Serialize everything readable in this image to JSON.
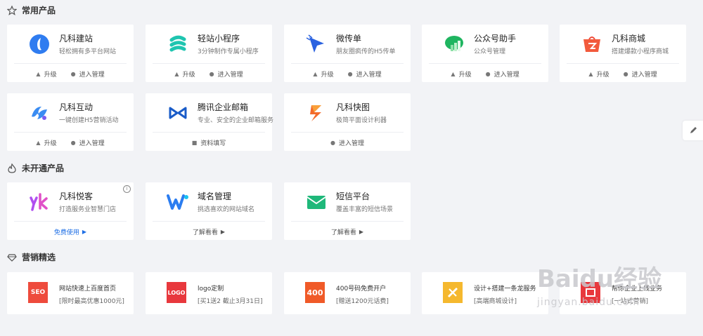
{
  "sections": {
    "common": "常用产品",
    "unopened": "未开通产品",
    "marketing": "营销精选"
  },
  "common_products": [
    {
      "name": "凡科建站",
      "desc": "轻松拥有多平台网站",
      "upgrade": "升级",
      "manage": "进入管理"
    },
    {
      "name": "轻站小程序",
      "desc": "3分钟制作专属小程序",
      "upgrade": "升级",
      "manage": "进入管理"
    },
    {
      "name": "微传单",
      "desc": "朋友圈疯传的H5传单",
      "upgrade": "升级",
      "manage": "进入管理"
    },
    {
      "name": "公众号助手",
      "desc": "公众号管理",
      "upgrade": "升级",
      "manage": "进入管理"
    },
    {
      "name": "凡科商城",
      "desc": "搭建爆款小程序商城",
      "upgrade": "升级",
      "manage": "进入管理"
    },
    {
      "name": "凡科互动",
      "desc": "一键创建H5营销活动",
      "upgrade": "升级",
      "manage": "进入管理"
    },
    {
      "name": "腾讯企业邮箱",
      "desc": "专业、安全的企业邮箱服务",
      "fill": "资料填写"
    },
    {
      "name": "凡科快图",
      "desc": "极简平面设计利器",
      "manage": "进入管理"
    }
  ],
  "unopened_products": [
    {
      "name": "凡科悦客",
      "desc": "打造服务业智慧门店",
      "action": "免费使用",
      "info": "i"
    },
    {
      "name": "域名管理",
      "desc": "挑选喜欢的网站域名",
      "action": "了解看看"
    },
    {
      "name": "短信平台",
      "desc": "覆盖丰富的短信场景",
      "action": "了解看看"
    }
  ],
  "marketing": [
    {
      "logo": "SEO",
      "title": "网站快速上百度首页",
      "sub": "[限时最高优惠1000元]",
      "color": "#ee4b3c"
    },
    {
      "logo": "LOGO",
      "title": "logo定制",
      "sub": "[买1送2 截止3月31日]",
      "color": "#e8383d"
    },
    {
      "logo": "400",
      "title": "400号码免费开户",
      "sub": "[赠送1200元话费]",
      "color": "#f05a28"
    },
    {
      "logo": "",
      "title": "设计+搭建一条龙服务",
      "sub": "[高端商城设计]",
      "color": "#f5b82e"
    },
    {
      "logo": "",
      "title": "帮你企业上线业务",
      "sub": "[一站式营销]",
      "color": "#e8383d"
    }
  ],
  "watermark": {
    "main": "Baidu经验",
    "url": "jingyan.baidu.com"
  },
  "icons": {
    "common": "star-icon",
    "unopened": "fire-icon",
    "marketing": "diamond-icon",
    "upgrade": "rocket-icon",
    "manage": "user-icon",
    "fill": "form-icon",
    "edit": "pencil-icon"
  },
  "colors": {
    "accent": "#1f6fe5",
    "background": "#f2f3f6"
  }
}
